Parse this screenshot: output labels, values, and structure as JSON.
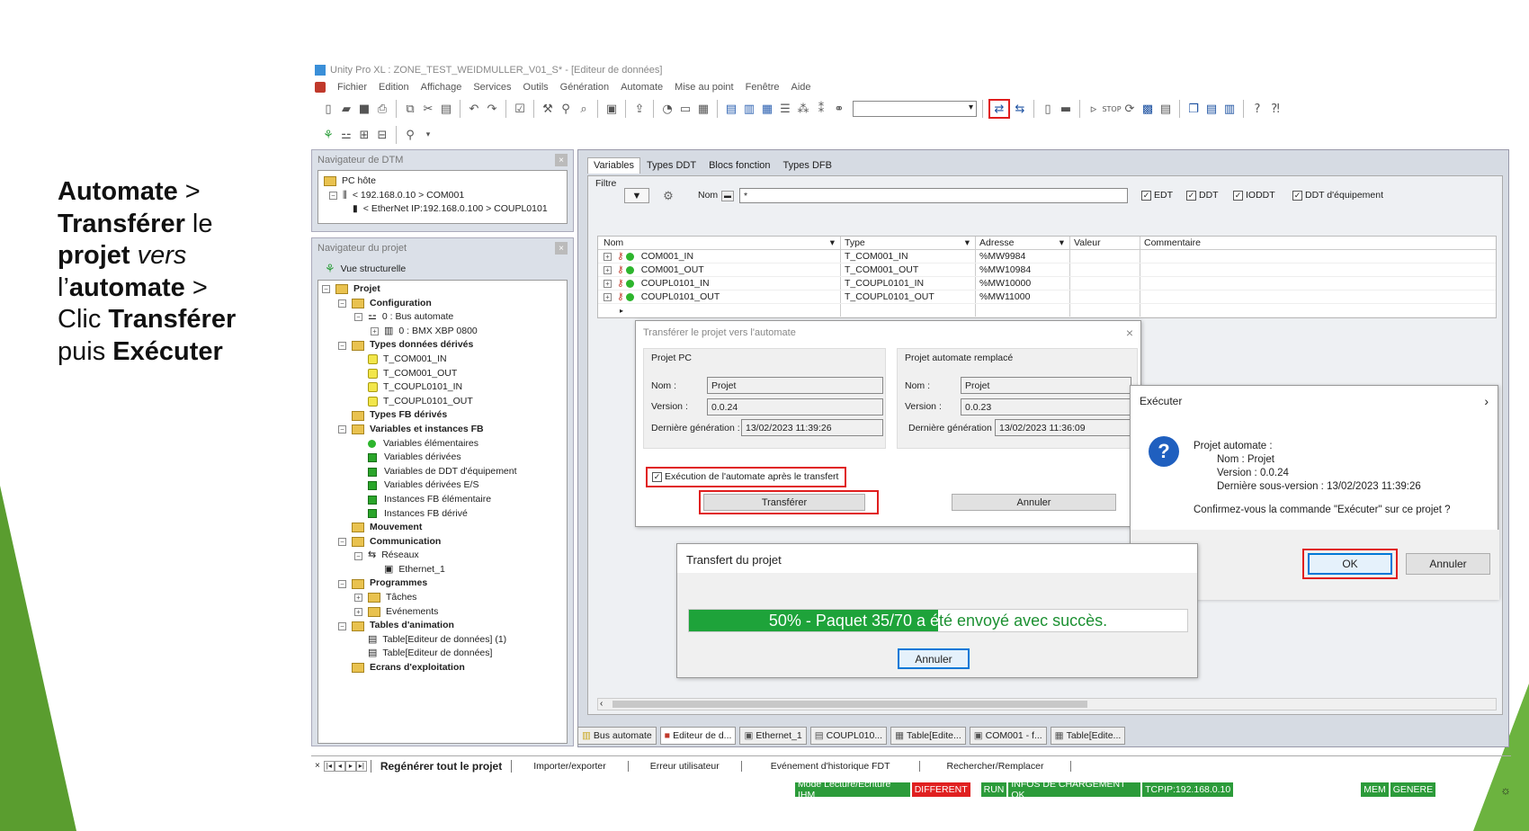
{
  "caption": {
    "p1": "Automate",
    "p2": " > ",
    "p3": "Transférer",
    "p4": " le ",
    "p5": "projet",
    "p6": " vers ",
    "p7": "l’",
    "p8": "automate",
    "p9": " > ",
    "p10": "Clic ",
    "p11": "Transférer",
    "p12": "puis ",
    "p13": "Exécuter"
  },
  "window": {
    "title": "Unity Pro XL : ZONE_TEST_WEIDMULLER_V01_S* - [Editeur de données]"
  },
  "menu": [
    "Fichier",
    "Edition",
    "Affichage",
    "Services",
    "Outils",
    "Génération",
    "Automate",
    "Mise au point",
    "Fenêtre",
    "Aide"
  ],
  "dtm": {
    "title": "Navigateur de DTM",
    "root": "PC hôte",
    "node1": "< 192.168.0.10 > COM001",
    "node2": "< EtherNet IP:192.168.0.100 > COUPL0101"
  },
  "project_nav": {
    "title": "Navigateur du projet",
    "view": "Vue structurelle",
    "items": [
      {
        "label": "Projet",
        "bold": true
      },
      {
        "label": "Configuration",
        "bold": true
      },
      {
        "label": "0 : Bus automate",
        "bold": false
      },
      {
        "label": "0 : BMX XBP 0800",
        "bold": false
      },
      {
        "label": "Types données dérivés",
        "bold": true
      },
      {
        "label": "T_COM001_IN",
        "bold": false
      },
      {
        "label": "T_COM001_OUT",
        "bold": false
      },
      {
        "label": "T_COUPL0101_IN",
        "bold": false
      },
      {
        "label": "T_COUPL0101_OUT",
        "bold": false
      },
      {
        "label": "Types FB dérivés",
        "bold": true
      },
      {
        "label": "Variables et instances FB",
        "bold": true
      },
      {
        "label": "Variables élémentaires",
        "bold": false
      },
      {
        "label": "Variables dérivées",
        "bold": false
      },
      {
        "label": "Variables de DDT d'équipement",
        "bold": false
      },
      {
        "label": "Variables dérivées E/S",
        "bold": false
      },
      {
        "label": "Instances FB élémentaire",
        "bold": false
      },
      {
        "label": "Instances FB dérivé",
        "bold": false
      },
      {
        "label": "Mouvement",
        "bold": true
      },
      {
        "label": "Communication",
        "bold": true
      },
      {
        "label": "Réseaux",
        "bold": false
      },
      {
        "label": "Ethernet_1",
        "bold": false
      },
      {
        "label": "Programmes",
        "bold": true
      },
      {
        "label": "Tâches",
        "bold": false
      },
      {
        "label": "Evénements",
        "bold": false
      },
      {
        "label": "Tables d'animation",
        "bold": true
      },
      {
        "label": "Table[Editeur de données] (1)",
        "bold": false
      },
      {
        "label": "Table[Editeur de données]",
        "bold": false
      },
      {
        "label": "Ecrans d'exploitation",
        "bold": true
      }
    ]
  },
  "editor": {
    "tabs": [
      "Variables",
      "Types DDT",
      "Blocs fonction",
      "Types DFB"
    ],
    "filter_label": "Filtre",
    "name_label": "Nom",
    "name_value": "*",
    "checks": [
      "EDT",
      "DDT",
      "IODDT",
      "DDT d'équipement"
    ],
    "columns": [
      "Nom",
      "Type",
      "Adresse",
      "Valeur",
      "Commentaire"
    ],
    "rows": [
      {
        "name": "COM001_IN",
        "type": "T_COM001_IN",
        "addr": "%MW9984"
      },
      {
        "name": "COM001_OUT",
        "type": "T_COM001_OUT",
        "addr": "%MW10984"
      },
      {
        "name": "COUPL0101_IN",
        "type": "T_COUPL0101_IN",
        "addr": "%MW10000"
      },
      {
        "name": "COUPL0101_OUT",
        "type": "T_COUPL0101_OUT",
        "addr": "%MW11000"
      }
    ]
  },
  "transfer_dialog": {
    "title": "Transférer le projet vers l'automate",
    "pc_title": "Projet PC",
    "plc_title": "Projet automate remplacé",
    "nom_label": "Nom :",
    "version_label": "Version :",
    "gen_label": "Dernière génération :",
    "pc_nom": "Projet",
    "pc_version": "0.0.24",
    "pc_gen": "13/02/2023 11:39:26",
    "plc_nom": "Projet",
    "plc_version": "0.0.23",
    "plc_gen": "13/02/2023 11:36:09",
    "exec_check": "Exécution de l'automate après le transfert",
    "transfer_btn": "Transférer",
    "cancel_btn": "Annuler"
  },
  "progress_dialog": {
    "title": "Transfert du projet",
    "progress": 0.5,
    "message": "50% - Paquet 35/70 a été envoyé avec succès.",
    "cancel_btn": "Annuler"
  },
  "execute_dialog": {
    "title": "Exécuter",
    "l1": "Projet automate :",
    "l2": "Nom :  Projet",
    "l3": "Version :  0.0.24",
    "l4": "Dernière sous-version :   13/02/2023 11:39:26",
    "question": "Confirmez-vous la commande \"Exécuter\" sur ce projet ?",
    "ok_btn": "OK",
    "cancel_btn": "Annuler"
  },
  "bottom_tabs": [
    "Bus automate",
    "Editeur de d...",
    "Ethernet_1",
    "COUPL010...",
    "Table[Edite...",
    "COM001 - f...",
    "Table[Edite..."
  ],
  "output_tabs": [
    "Regénérer tout le projet",
    "Importer/exporter",
    "Erreur utilisateur",
    "Evénement d'historique FDT",
    "Rechercher/Remplacer"
  ],
  "status": {
    "mode": "Mode Lecture/Ecriture IHM",
    "diff": "DIFFERENT",
    "run": "RUN",
    "load": "INFOS DE CHARGEMENT OK",
    "tcp": "TCPIP:192.168.0.10",
    "mem": "MEM",
    "gen": "GENERE"
  },
  "colors": {
    "accent_green": "#2c9b3a",
    "highlight_red": "#e01e1e",
    "progress_green": "#1ea33a"
  }
}
